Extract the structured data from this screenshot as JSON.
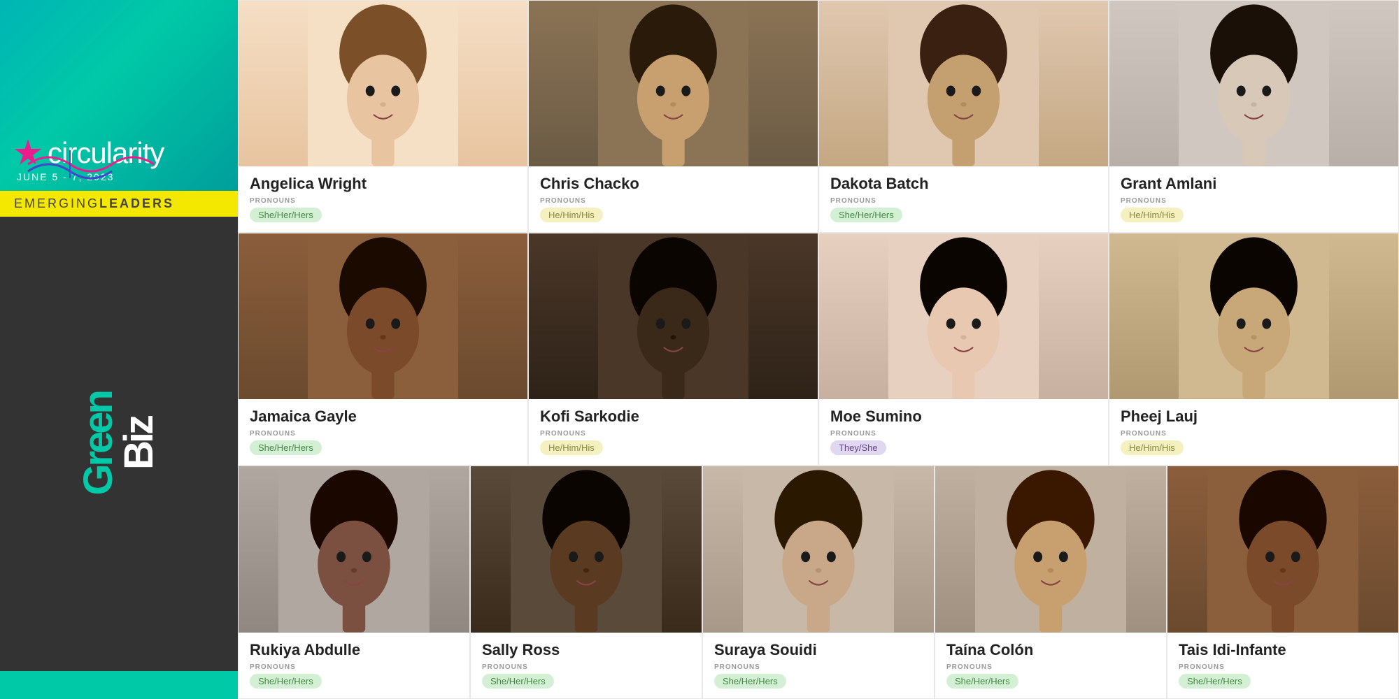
{
  "sidebar": {
    "logo": {
      "event_name": "circularity",
      "date": "JUNE 5 - 7, 2023",
      "emerging": "EMERGING",
      "leaders": "LEADERS",
      "green": "Green",
      "biz": "Biz"
    }
  },
  "people": [
    {
      "id": "angelica-wright",
      "name": "Angelica Wright",
      "pronouns_label": "PRONOUNS",
      "pronouns": "She/Her/Hers",
      "badge_class": "badge-green",
      "photo_class": "photo-angelica",
      "skin": "#e8c4a0",
      "hair": "#7B4F28",
      "bg": "#f5dfc5"
    },
    {
      "id": "chris-chacko",
      "name": "Chris Chacko",
      "pronouns_label": "PRONOUNS",
      "pronouns": "He/Him/His",
      "badge_class": "badge-yellow",
      "photo_class": "photo-chris",
      "skin": "#C8A070",
      "hair": "#2A1A0A",
      "bg": "#8B7355"
    },
    {
      "id": "dakota-batch",
      "name": "Dakota Batch",
      "pronouns_label": "PRONOUNS",
      "pronouns": "She/Her/Hers",
      "badge_class": "badge-green",
      "photo_class": "photo-dakota",
      "skin": "#c4a070",
      "hair": "#3A2010",
      "bg": "#e0c8b0"
    },
    {
      "id": "grant-amlani",
      "name": "Grant Amlani",
      "pronouns_label": "PRONOUNS",
      "pronouns": "He/Him/His",
      "badge_class": "badge-yellow",
      "photo_class": "photo-grant",
      "skin": "#d8c8b8",
      "hair": "#1A1008",
      "bg": "#d0c8c0"
    },
    {
      "id": "jamaica-gayle",
      "name": "Jamaica Gayle",
      "pronouns_label": "PRONOUNS",
      "pronouns": "She/Her/Hers",
      "badge_class": "badge-green",
      "photo_class": "photo-jamaica",
      "skin": "#7B4A2A",
      "hair": "#1A0A00",
      "bg": "#8B5E3C"
    },
    {
      "id": "kofi-sarkodie",
      "name": "Kofi Sarkodie",
      "pronouns_label": "PRONOUNS",
      "pronouns": "He/Him/His",
      "badge_class": "badge-yellow",
      "photo_class": "photo-kofi",
      "skin": "#3A2818",
      "hair": "#0A0500",
      "bg": "#4A3728"
    },
    {
      "id": "moe-sumino",
      "name": "Moe Sumino",
      "pronouns_label": "PRONOUNS",
      "pronouns": "They/She",
      "badge_class": "badge-lavender",
      "photo_class": "photo-moe",
      "skin": "#E8C8B0",
      "hair": "#0A0500",
      "bg": "#E8D0C0"
    },
    {
      "id": "pheej-lauj",
      "name": "Pheej Lauj",
      "pronouns_label": "PRONOUNS",
      "pronouns": "He/Him/His",
      "badge_class": "badge-yellow",
      "photo_class": "photo-pheej",
      "skin": "#C8A878",
      "hair": "#0A0500",
      "bg": "#D0B890"
    },
    {
      "id": "rukiya-abdulle",
      "name": "Rukiya Abdulle",
      "pronouns_label": "PRONOUNS",
      "pronouns": "She/Her/Hers",
      "badge_class": "badge-green",
      "photo_class": "photo-rukiya",
      "skin": "#7B5040",
      "hair": "#1A0800",
      "bg": "#B0A8A0"
    },
    {
      "id": "sally-ross",
      "name": "Sally Ross",
      "pronouns_label": "PRONOUNS",
      "pronouns": "She/Her/Hers",
      "badge_class": "badge-green",
      "photo_class": "photo-sally",
      "skin": "#5A3A20",
      "hair": "#0A0500",
      "bg": "#5A4A3A"
    },
    {
      "id": "suraya-souidi",
      "name": "Suraya Souidi",
      "pronouns_label": "PRONOUNS",
      "pronouns": "She/Her/Hers",
      "badge_class": "badge-green",
      "photo_class": "photo-suraya",
      "skin": "#C8A888",
      "hair": "#2A1800",
      "bg": "#C8B8A8"
    },
    {
      "id": "taina-colon",
      "name": "Taína Colón",
      "pronouns_label": "PRONOUNS",
      "pronouns": "She/Her/Hers",
      "badge_class": "badge-green",
      "photo_class": "photo-taina",
      "skin": "#C8A070",
      "hair": "#3A1800",
      "bg": "#C0B0A0"
    },
    {
      "id": "tais-idi-infante",
      "name": "Tais Idi-Infante",
      "pronouns_label": "PRONOUNS",
      "pronouns": "She/Her/Hers",
      "badge_class": "badge-green",
      "photo_class": "photo-tais",
      "skin": "#7B4A2A",
      "hair": "#1A0800",
      "bg": "#8B5E3C"
    }
  ]
}
